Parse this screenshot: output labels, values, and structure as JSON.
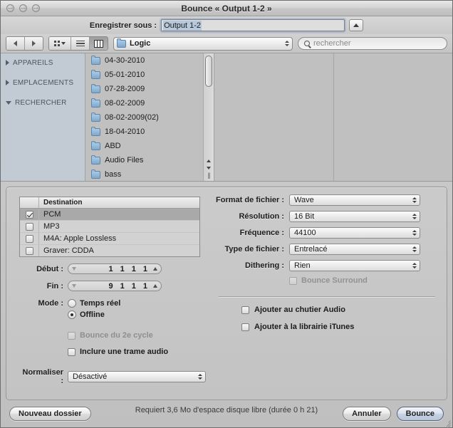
{
  "window": {
    "title": "Bounce « Output 1-2 »",
    "traffic_lights": [
      "close",
      "minimize",
      "zoom"
    ]
  },
  "save_as": {
    "label": "Enregistrer sous :",
    "value": "Output 1-2",
    "placeholder": "",
    "disclosure_icon": "triangle-up-icon"
  },
  "toolbar": {
    "back_icon": "back-arrow-icon",
    "forward_icon": "forward-arrow-icon",
    "icon_view_icon": "icon-view-icon",
    "list_view_icon": "list-view-icon",
    "column_view_icon": "column-view-icon",
    "active_view": "column",
    "path_popup": {
      "label": "Logic",
      "icon": "folder-icon"
    },
    "search": {
      "icon": "search-icon",
      "placeholder": "rechercher",
      "value": ""
    }
  },
  "sidebar": {
    "sections": [
      {
        "label": "APPAREILS",
        "expanded": false,
        "icon": "disclosure-right-icon"
      },
      {
        "label": "EMPLACEMENTS",
        "expanded": false,
        "icon": "disclosure-right-icon"
      },
      {
        "label": "RECHERCHER",
        "expanded": true,
        "icon": "disclosure-down-icon"
      }
    ]
  },
  "file_browser": {
    "column1": [
      {
        "name": "04-30-2010",
        "has_children": true
      },
      {
        "name": "05-01-2010",
        "has_children": true
      },
      {
        "name": "07-28-2009",
        "has_children": true
      },
      {
        "name": "08-02-2009",
        "has_children": true
      },
      {
        "name": "08-02-2009(02)",
        "has_children": true
      },
      {
        "name": "18-04-2010",
        "has_children": true
      },
      {
        "name": "ABD",
        "has_children": true
      },
      {
        "name": "Audio Files",
        "has_children": true
      },
      {
        "name": "bass",
        "has_children": true
      }
    ]
  },
  "destination_table": {
    "header": "Destination",
    "rows": [
      {
        "label": "PCM",
        "checked": true,
        "selected": true
      },
      {
        "label": "MP3",
        "checked": false,
        "selected": false
      },
      {
        "label": "M4A: Apple Lossless",
        "checked": false,
        "selected": false
      },
      {
        "label": "Graver: CDDA",
        "checked": false,
        "selected": false
      }
    ]
  },
  "left_pane": {
    "start": {
      "label": "Début :",
      "values": [
        "1",
        "1",
        "1",
        "1"
      ]
    },
    "end": {
      "label": "Fin :",
      "values": [
        "9",
        "1",
        "1",
        "1"
      ]
    },
    "mode": {
      "label": "Mode :",
      "options": [
        {
          "label": "Temps réel",
          "selected": false
        },
        {
          "label": "Offline",
          "selected": true
        }
      ]
    },
    "second_cycle": {
      "label": "Bounce du 2e cycle",
      "checked": false,
      "disabled": true
    },
    "include_audio_tail": {
      "label": "Inclure une trame audio",
      "checked": false,
      "disabled": false
    },
    "normalize": {
      "label": "Normaliser :",
      "value": "Désactivé"
    }
  },
  "right_pane": {
    "file_format": {
      "label": "Format de fichier :",
      "value": "Wave"
    },
    "resolution": {
      "label": "Résolution :",
      "value": "16 Bit"
    },
    "sample_rate": {
      "label": "Fréquence :",
      "value": "44100"
    },
    "file_type": {
      "label": "Type de fichier :",
      "value": "Entrelacé"
    },
    "dithering": {
      "label": "Dithering :",
      "value": "Rien"
    },
    "bounce_surround": {
      "label": "Bounce Surround",
      "checked": false,
      "disabled": true
    },
    "add_to_audio_bin": {
      "label": "Ajouter au chutier Audio",
      "checked": false
    },
    "add_to_itunes": {
      "label": "Ajouter à la librairie iTunes",
      "checked": false
    },
    "disk_note": "Requiert 3,6 Mo d'espace disque libre (durée 0 h 21)"
  },
  "footer": {
    "new_folder": "Nouveau dossier",
    "cancel": "Annuler",
    "bounce": "Bounce"
  }
}
